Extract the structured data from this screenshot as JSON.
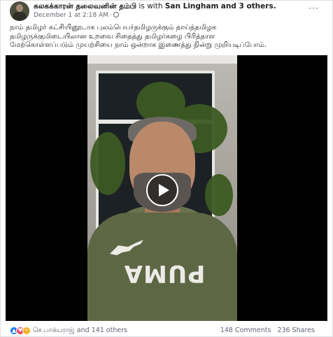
{
  "post": {
    "author": "கலகக்காரன் தலைவனின் தம்பி",
    "with_prefix": "is with",
    "tagged_person": "San Lingham",
    "and_others": "and 3 others.",
    "timestamp": "December 1 at 2:18 AM",
    "privacy_icon": "globe-icon",
    "more_label": "···",
    "text_lines": [
      "நாம் தமிழர் கட்சியினூடாக புலம்பெயர்தமிழருக்கும் தாய்த்தமிழக",
      "தமிழருக்குமிடையிலான உறவை சிதைத்து தமிழர்கழை பிரித்தாள",
      "மேற்கொள்ளப்படும் முயற்சியை நாம் ஒன்றாக இணைத்து நின்று முறியடிப்போம்."
    ]
  },
  "video": {
    "shirt_text": "PUMA",
    "play_icon": "play-icon"
  },
  "footer": {
    "reaction_icons": [
      "like-icon",
      "love-icon",
      "sad-icon"
    ],
    "reactor_name": "செ.பாக்யராஜ்",
    "reactor_others": "and 141 others",
    "comments": "148 Comments",
    "shares": "236 Shares"
  },
  "colors": {
    "like": "#1877f2",
    "love": "#f33e58",
    "sad": "#f7b125",
    "meta_text": "#606770",
    "hoodie": "#5e6744"
  }
}
